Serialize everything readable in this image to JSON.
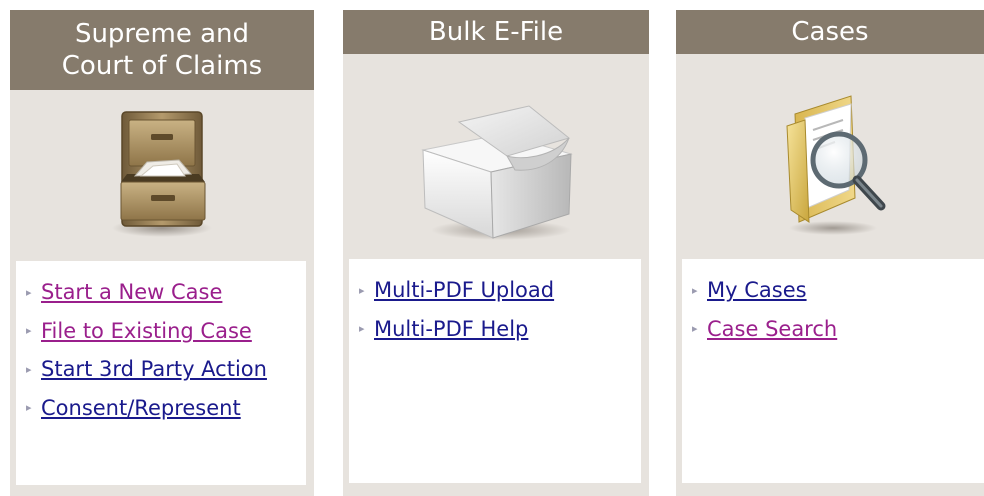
{
  "panels": [
    {
      "title_line1": "Supreme and",
      "title_line2": "Court of Claims",
      "icon": "file-cabinet-icon",
      "links": [
        {
          "label": "Start a New Case",
          "state": "visited"
        },
        {
          "label": "File to Existing Case",
          "state": "visited"
        },
        {
          "label": "Start 3rd Party Action",
          "state": "unvisited"
        },
        {
          "label": "Consent/Represent",
          "state": "unvisited"
        }
      ]
    },
    {
      "title": "Bulk E-File",
      "icon": "paper-box-icon",
      "links": [
        {
          "label": "Multi-PDF Upload",
          "state": "unvisited"
        },
        {
          "label": "Multi-PDF Help",
          "state": "unvisited"
        }
      ]
    },
    {
      "title": "Cases",
      "icon": "folder-search-icon",
      "links": [
        {
          "label": "My Cases",
          "state": "unvisited"
        },
        {
          "label": "Case Search",
          "state": "visited"
        }
      ]
    }
  ],
  "colors": {
    "header_bg": "#867b6c",
    "panel_bg": "#e7e3de",
    "link_unvisited": "#1a1a8c",
    "link_visited": "#9a1f8c"
  }
}
